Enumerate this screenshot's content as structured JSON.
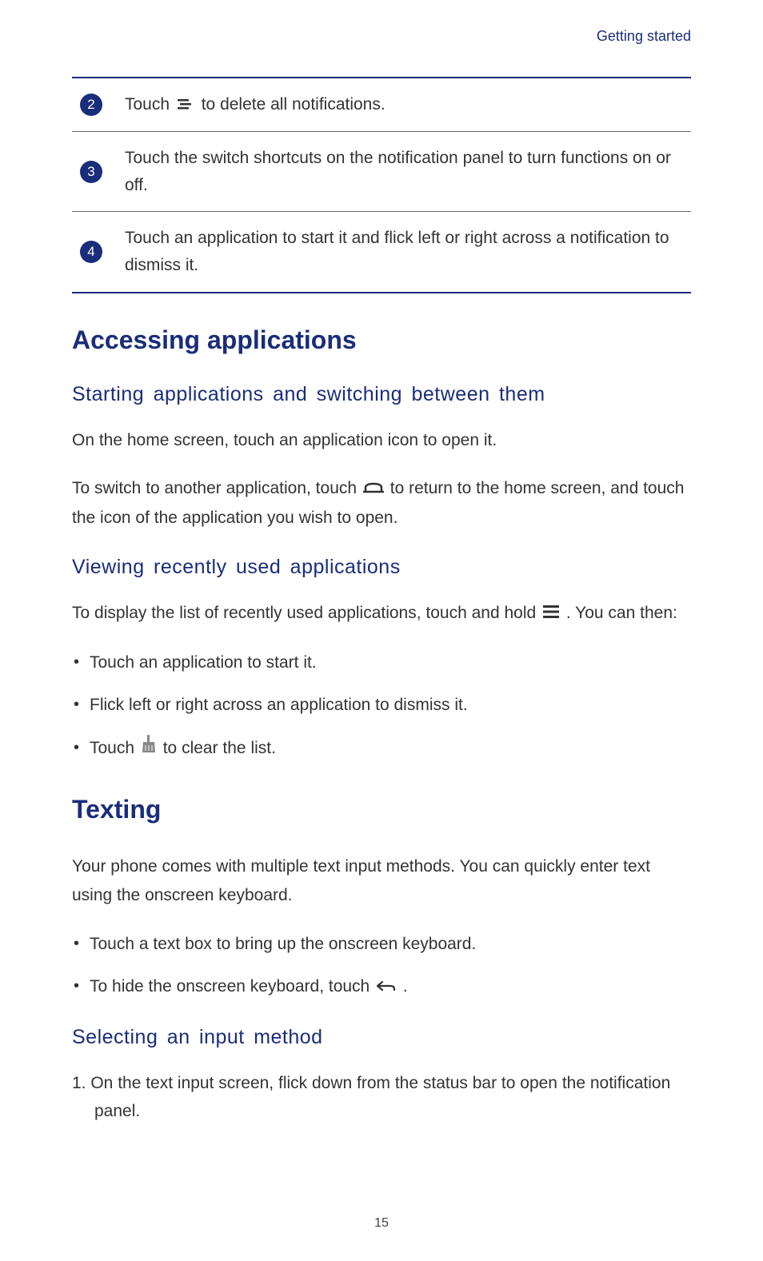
{
  "header": {
    "section_label": "Getting started"
  },
  "number_rows": [
    {
      "num": "2",
      "text_before": "Touch ",
      "text_after": " to delete all notifications.",
      "icon": "clear-notifications-icon"
    },
    {
      "num": "3",
      "text": "Touch the switch shortcuts on the notification panel to turn functions on or off."
    },
    {
      "num": "4",
      "text": "Touch an application to start it and flick left or right across a notification to dismiss it."
    }
  ],
  "sections": {
    "accessing_apps": {
      "title": "Accessing applications",
      "starting": {
        "heading": "Starting applications and switching between them",
        "p1": "On the home screen, touch an application icon to open it.",
        "p2_before": "To switch to another application, touch ",
        "p2_after": " to return to the home screen, and touch the icon of the application you wish to open."
      },
      "recent": {
        "heading": "Viewing recently used applications",
        "p1_before": "To display the list of recently used applications, touch and hold ",
        "p1_after": " . You can then:",
        "bullets": {
          "b1": "Touch an application to start it.",
          "b2": "Flick left or right across an application to dismiss it.",
          "b3_before": "Touch ",
          "b3_after": " to clear the list."
        }
      }
    },
    "texting": {
      "title": "Texting",
      "intro": "Your phone comes with multiple text input methods. You can quickly enter text using the onscreen keyboard.",
      "bullets": {
        "b1": "Touch a text box to bring up the onscreen keyboard.",
        "b2_before": "To hide the onscreen keyboard, touch ",
        "b2_after": " ."
      },
      "selecting": {
        "heading": "Selecting an input method",
        "step1": "1. On the text input screen, flick down from the status bar to open the notification panel."
      }
    }
  },
  "page_number": "15"
}
